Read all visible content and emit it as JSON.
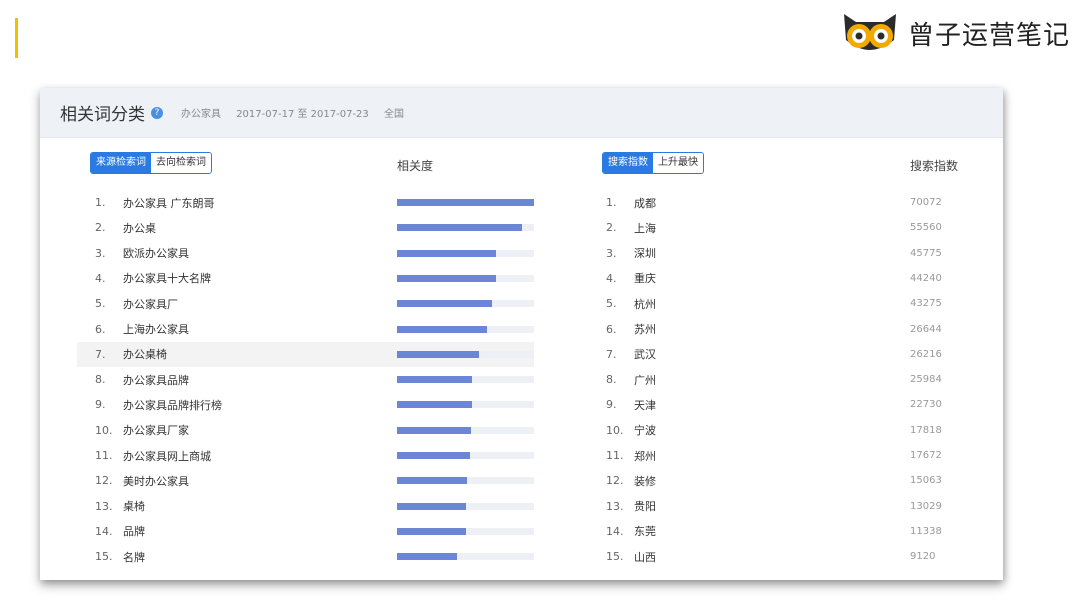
{
  "brand": {
    "name": "曾子运营笔记"
  },
  "card": {
    "title": "相关词分类",
    "keyword": "办公家具",
    "date_range": "2017-07-17 至 2017-07-23",
    "region": "全国"
  },
  "left": {
    "tabs": [
      "来源检索词",
      "去向检索词"
    ],
    "active_tab": 0,
    "col_header": "相关度",
    "items": [
      {
        "n": "1.",
        "term": "办公家具 广东朗哥",
        "rel": 1.0
      },
      {
        "n": "2.",
        "term": "办公桌",
        "rel": 0.91
      },
      {
        "n": "3.",
        "term": "欧派办公家具",
        "rel": 0.72
      },
      {
        "n": "4.",
        "term": "办公家具十大名牌",
        "rel": 0.72
      },
      {
        "n": "5.",
        "term": "办公家具厂",
        "rel": 0.69
      },
      {
        "n": "6.",
        "term": "上海办公家具",
        "rel": 0.66
      },
      {
        "n": "7.",
        "term": "办公桌椅",
        "rel": 0.6
      },
      {
        "n": "8.",
        "term": "办公家具品牌",
        "rel": 0.55
      },
      {
        "n": "9.",
        "term": "办公家具品牌排行榜",
        "rel": 0.55
      },
      {
        "n": "10.",
        "term": "办公家具厂家",
        "rel": 0.54
      },
      {
        "n": "11.",
        "term": "办公家具网上商城",
        "rel": 0.53
      },
      {
        "n": "12.",
        "term": "美时办公家具",
        "rel": 0.51
      },
      {
        "n": "13.",
        "term": "桌椅",
        "rel": 0.5
      },
      {
        "n": "14.",
        "term": "品牌",
        "rel": 0.5
      },
      {
        "n": "15.",
        "term": "名牌",
        "rel": 0.44
      }
    ]
  },
  "right": {
    "tabs": [
      "搜索指数",
      "上升最快"
    ],
    "active_tab": 0,
    "col_header": "搜索指数",
    "items": [
      {
        "n": "1.",
        "term": "成都",
        "value": "70072"
      },
      {
        "n": "2.",
        "term": "上海",
        "value": "55560"
      },
      {
        "n": "3.",
        "term": "深圳",
        "value": "45775"
      },
      {
        "n": "4.",
        "term": "重庆",
        "value": "44240"
      },
      {
        "n": "5.",
        "term": "杭州",
        "value": "43275"
      },
      {
        "n": "6.",
        "term": "苏州",
        "value": "26644"
      },
      {
        "n": "7.",
        "term": "武汉",
        "value": "26216"
      },
      {
        "n": "8.",
        "term": "广州",
        "value": "25984"
      },
      {
        "n": "9.",
        "term": "天津",
        "value": "22730"
      },
      {
        "n": "10.",
        "term": "宁波",
        "value": "17818"
      },
      {
        "n": "11.",
        "term": "郑州",
        "value": "17672"
      },
      {
        "n": "12.",
        "term": "装修",
        "value": "15063"
      },
      {
        "n": "13.",
        "term": "贵阳",
        "value": "13029"
      },
      {
        "n": "14.",
        "term": "东莞",
        "value": "11338"
      },
      {
        "n": "15.",
        "term": "山西",
        "value": "9120"
      }
    ]
  },
  "colors": {
    "accent": "#f3c000",
    "bar": "#6b86d6",
    "active_tab": "#2a7ae2"
  }
}
